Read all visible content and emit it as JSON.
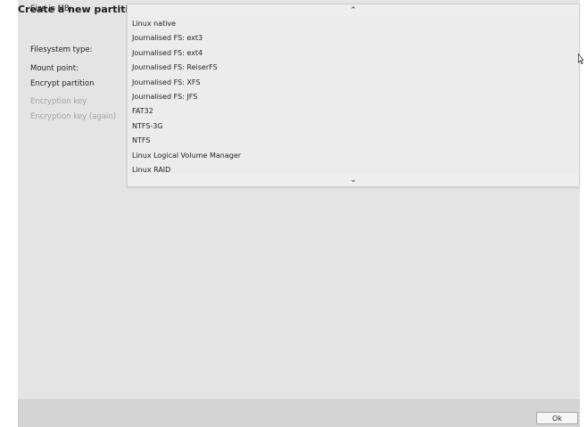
{
  "dialog": {
    "title": "Create a new partitic"
  },
  "form": {
    "size_label": "Size in MB:",
    "filesystem_label": "Filesystem type:",
    "mount_label": "Mount point:",
    "encrypt_label": "Encrypt partition",
    "key_label": "Encryption key",
    "key_again_label": "Encryption key (again)"
  },
  "dropdown": {
    "scroll_up": "⌃",
    "scroll_down": "⌄",
    "options": [
      "Linux native",
      "Journalised FS: ext3",
      "Journalised FS: ext4",
      "Journalised FS: ReiserFS",
      "Journalised FS: XFS",
      "Journalised FS: JFS",
      "FAT32",
      "NTFS-3G",
      "NTFS",
      "Linux Logical Volume Manager",
      "Linux RAID"
    ]
  },
  "footer": {
    "ok_label": "Ok"
  },
  "icons": {
    "cursor": "mouse-cursor-icon"
  }
}
